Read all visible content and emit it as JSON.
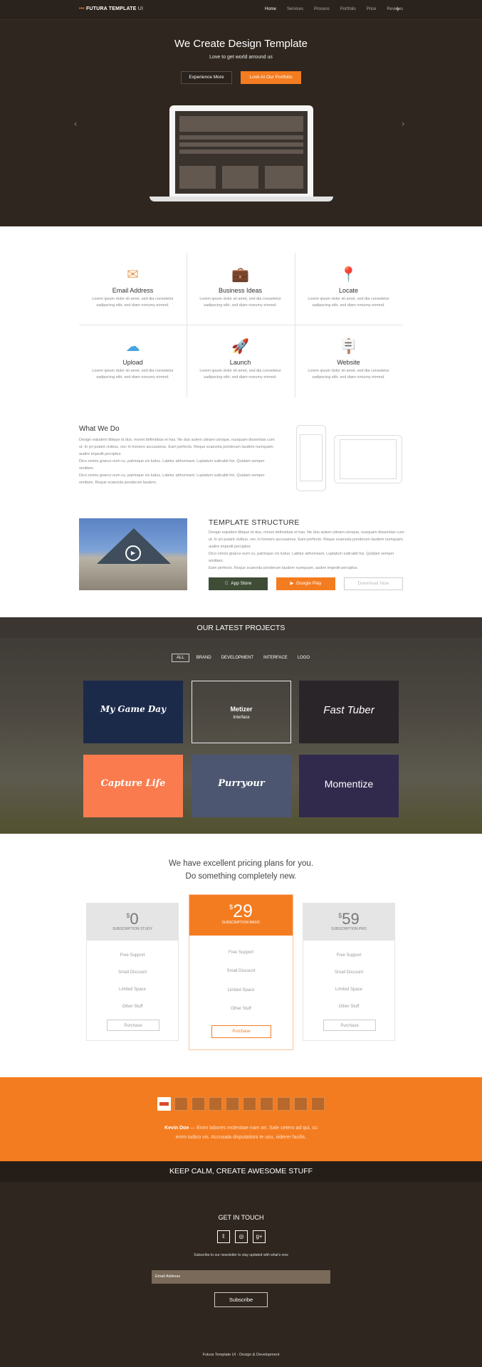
{
  "nav": {
    "logo": "FUTURA TEMPLATE",
    "logo_suffix": "UI",
    "items": [
      "Home",
      "Services",
      "Process",
      "Portfolio",
      "Price",
      "Reviews"
    ],
    "active": "Home"
  },
  "hero": {
    "title": "We Create Design Template",
    "subtitle": "Love to get world arround us",
    "btn_secondary": "Experience More",
    "btn_primary": "Look At Our Portfolio"
  },
  "features": [
    {
      "title": "Email Address",
      "icon": "envelope-icon",
      "text1": "Lorem ipsum dolor sit amet,  sed dia  consetetur",
      "text2": "sadipscing elitr, sed diam nonumy eirmod."
    },
    {
      "title": "Business Ideas",
      "icon": "briefcase-icon",
      "text1": "Lorem ipsum dolor sit amet,  sed dia  consetetur",
      "text2": "sadipscing elitr, sed diam nonumy eirmod."
    },
    {
      "title": "Locate",
      "icon": "location-pin-icon",
      "text1": "Lorem ipsum dolor sit amet,  sed dia  consetetur",
      "text2": "sadipscing elitr, sed diam nonumy eirmod."
    },
    {
      "title": "Upload",
      "icon": "cloud-upload-icon",
      "text1": "Lorem ipsum dolor sit amet,  sed dia  consetetur",
      "text2": "sadipscing elitr, sed diam nonumy eirmod."
    },
    {
      "title": "Launch",
      "icon": "rocket-icon",
      "text1": "Lorem ipsum dolor sit amet,  sed dia  consetetur",
      "text2": "sadipscing elitr, sed diam nonumy eirmod."
    },
    {
      "title": "Website",
      "icon": "signpost-icon",
      "text1": "Lorem ipsum dolor sit amet,  sed dia  consetetur",
      "text2": "sadipscing elitr, sed diam nonumy eirmod."
    }
  ],
  "what_we_do": {
    "title": "What We Do",
    "lines": [
      "Design eqiudem tibique id duo, movet definiebas et has. Ne duo autem utinam utroque, nusquam dissentias cum",
      "ut. In pri putant civibus, nec in homero accusamus. Eam perfecto. Reque scaevola ponderum laudem numquam,",
      "audire impedit percipitur.",
      "Dico omnis graeco eum cu, patrioque vix ludus.  Labitur abhorreant. Luptatum iudicabit his. Quidam semper",
      "omittam.",
      "Dico omnis graeco eum cu, patrioque vix ludus. Labitur abhorreant. Luptatum iudicabit his. Quidam semper",
      "omittam. Reque scaevola ponderum laudem."
    ]
  },
  "template_structure": {
    "title": "TEMPLATE STRUCTURE",
    "lines": [
      "Design eqiudem tibique id duo, movet definiebas et has. Ne duo autem utinam utroque, nusquam dissentias cum",
      "ut. In pri putant civibus, nec in homero accusamus. Eam perfecto. Reque scaevola ponderum laudem numquam,",
      "audire impedit percipitur.",
      "Dico omnis graeco eum cu, patrioque vix ludus.  Labitur abhorreant. Luptatum iudicabit his. Quidam semper",
      "omittam.",
      "Eam perfecto. Reque scaevola ponderum laudem numquam, audire impedit percipitur."
    ],
    "app_store": "App Store",
    "google_play": "Google Play",
    "download": "Download Now"
  },
  "projects": {
    "title": "OUR LATEST PROJECTS",
    "filters": [
      "ALL",
      "BRAND",
      "DEVELOPMENT",
      "INTERFACE",
      "LOGO"
    ],
    "active_filter": "ALL",
    "tiles": [
      {
        "label": "My Game Day",
        "bg": "#1c2a4a"
      },
      {
        "label": "Metizer",
        "sub": "Interface",
        "bg": "transparent"
      },
      {
        "label": "Fast Tuber",
        "bg": "#2a2528"
      },
      {
        "label": "Capture Life",
        "bg": "#fa7c4e"
      },
      {
        "label": "Purryour",
        "bg": "#4d5670"
      },
      {
        "label": "Momentize",
        "bg": "#322a4c"
      }
    ]
  },
  "pricing": {
    "heading1": "We have excellent pricing plans for you.",
    "heading2": "Do something completely new.",
    "plans": [
      {
        "currency": "$",
        "amount": "0",
        "name": "SUBSCRIPTION STUDY",
        "button": "Purchase"
      },
      {
        "currency": "$",
        "amount": "29",
        "name": "SUBSCRIPTION BASIC",
        "button": "Purchase"
      },
      {
        "currency": "$",
        "amount": "59",
        "name": "SUBSCRIPTION PRO",
        "button": "Purchase"
      }
    ],
    "features": [
      "Free Support",
      "Small Discount",
      "Limited Space",
      "Other Stuff"
    ]
  },
  "testimonial": {
    "name": "Kevin Doe",
    "line1": " — Enim labores molestiae nam an. Sale cetero ad qui, cu",
    "line2": "enim iudico vis. Accusata disputationi te usu, viderer facilis."
  },
  "footer": {
    "banner": "KEEP CALM, CREATE AWESOME STUFF",
    "get_in_touch": "GET IN TOUCH",
    "social": [
      "twitter-icon",
      "dribbble-icon",
      "google-plus-icon"
    ],
    "newsletter": "Subscribe to our newsletter to stay updated with what's new",
    "email_placeholder": "Email Address",
    "subscribe": "Subscribe",
    "copyright": "Futura Template UI - Design & Development"
  },
  "colors": {
    "accent": "#f47c20",
    "dark": "#2f261f"
  }
}
